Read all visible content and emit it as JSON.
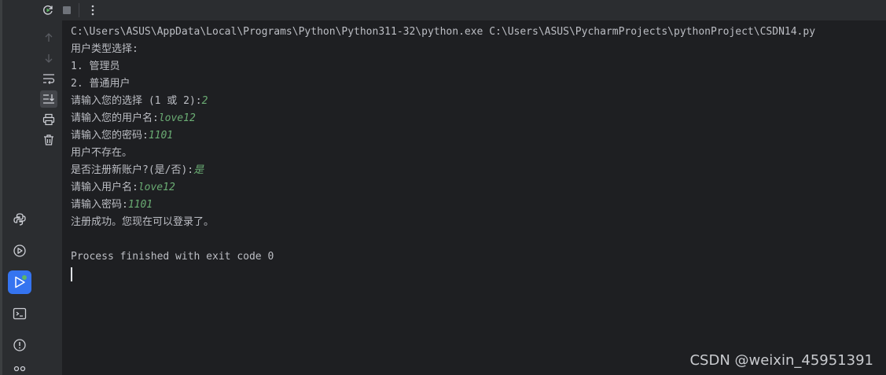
{
  "console": {
    "command": "C:\\Users\\ASUS\\AppData\\Local\\Programs\\Python\\Python311-32\\python.exe C:\\Users\\ASUS\\PycharmProjects\\pythonProject\\CSDN14.py",
    "lines": [
      {
        "text": "用户类型选择:",
        "input": ""
      },
      {
        "text": "1. 管理员",
        "input": ""
      },
      {
        "text": "2. 普通用户",
        "input": ""
      },
      {
        "text": "请输入您的选择 (1 或 2):",
        "input": "2"
      },
      {
        "text": "请输入您的用户名:",
        "input": "love12"
      },
      {
        "text": "请输入您的密码:",
        "input": "1101"
      },
      {
        "text": "用户不存在。",
        "input": ""
      },
      {
        "text": "是否注册新账户?(是/否):",
        "input": "是"
      },
      {
        "text": "请输入用户名:",
        "input": "love12"
      },
      {
        "text": "请输入密码:",
        "input": "1101"
      },
      {
        "text": "注册成功。您现在可以登录了。",
        "input": ""
      },
      {
        "text": "",
        "input": ""
      },
      {
        "text": "Process finished with exit code 0",
        "input": ""
      }
    ]
  },
  "toolbar": {
    "icons": [
      "rerun-icon",
      "stop-icon",
      "more-options-icon"
    ]
  },
  "gutter": {
    "icons": [
      "scroll-up-icon",
      "scroll-down-icon",
      "soft-wrap-icon",
      "scroll-to-end-icon",
      "print-icon",
      "clear-all-icon"
    ]
  },
  "stripe": {
    "icons": [
      "python-console-icon",
      "services-icon",
      "run-icon",
      "terminal-icon",
      "problems-icon",
      "version-control-icon"
    ]
  },
  "watermark": "CSDN @weixin_45951391",
  "colors": {
    "background": "#1e1f22",
    "panel": "#2b2d30",
    "text": "#bcbec4",
    "user_input": "#6aab73",
    "accent": "#3574f0",
    "run_ok": "#5fb865"
  }
}
